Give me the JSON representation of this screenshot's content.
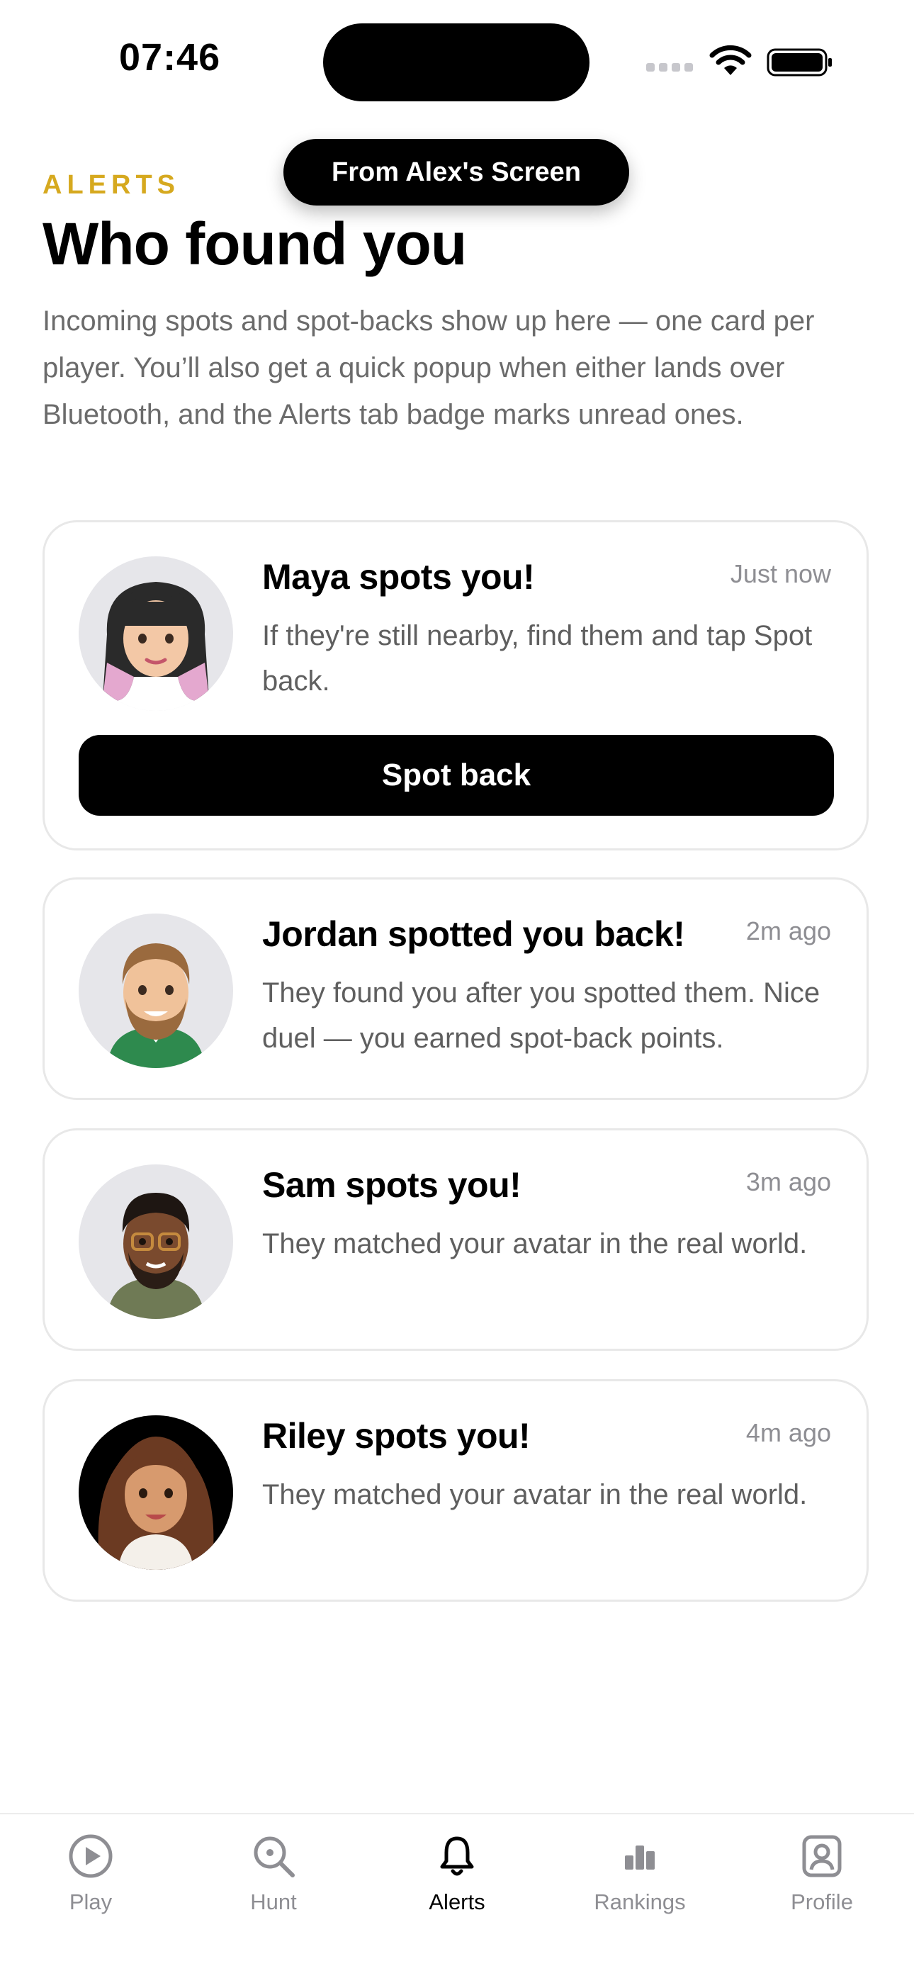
{
  "status_bar": {
    "time": "07:46"
  },
  "banner": {
    "text": "From Alex's Screen"
  },
  "header": {
    "eyebrow": "ALERTS",
    "title": "Who found you",
    "description": "Incoming spots and spot-backs show up here — one card per player. You’ll also get a quick popup when either lands over Bluetooth, and the Alerts tab badge marks unread ones."
  },
  "alerts": [
    {
      "title": "Maya spots you!",
      "time": "Just now",
      "body": "If they're still nearby, find them and tap Spot back.",
      "action_label": "Spot back",
      "avatar": "maya-avatar"
    },
    {
      "title": "Jordan spotted you back!",
      "time": "2m ago",
      "body": "They found you after you spotted them. Nice duel — you earned spot-back points.",
      "avatar": "jordan-avatar"
    },
    {
      "title": "Sam spots you!",
      "time": "3m ago",
      "body": "They matched your avatar in the real world.",
      "avatar": "sam-avatar"
    },
    {
      "title": "Riley spots you!",
      "time": "4m ago",
      "body": "They matched your avatar in the real world.",
      "avatar": "riley-avatar"
    }
  ],
  "tabbar": {
    "items": [
      {
        "label": "Play",
        "icon": "play-icon"
      },
      {
        "label": "Hunt",
        "icon": "search-icon"
      },
      {
        "label": "Alerts",
        "icon": "bell-icon",
        "active": true
      },
      {
        "label": "Rankings",
        "icon": "bar-chart-icon"
      },
      {
        "label": "Profile",
        "icon": "profile-icon"
      }
    ]
  },
  "colors": {
    "accent": "#d6a91f",
    "text": "#000000",
    "muted": "#8e8e93",
    "border": "#e8e8e8"
  }
}
